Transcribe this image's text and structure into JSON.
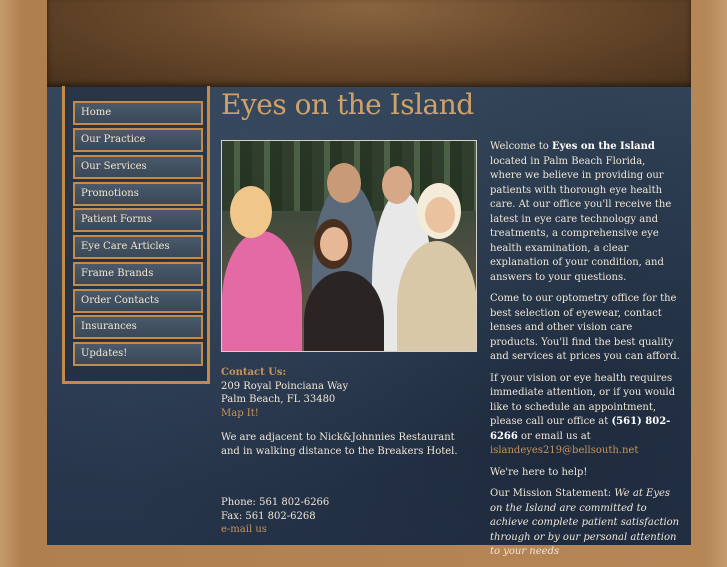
{
  "site": {
    "title": "Eyes on the Island"
  },
  "nav": [
    {
      "label": "Home"
    },
    {
      "label": "Our Practice"
    },
    {
      "label": "Our Services"
    },
    {
      "label": "Promotions"
    },
    {
      "label": "Patient Forms"
    },
    {
      "label": "Eye Care Articles"
    },
    {
      "label": "Frame Brands"
    },
    {
      "label": "Order Contacts"
    },
    {
      "label": "Insurances"
    },
    {
      "label": "Updates!"
    }
  ],
  "contact": {
    "heading": "Contact Us:",
    "address1": "209 Royal Poinciana Way",
    "address2": "Palm Beach, FL 33480",
    "map_link": "Map It!",
    "note": "We are adjacent to Nick&Johnnies Restaurant and in walking distance to the Breakers Hotel.",
    "phone": "Phone: 561 802-6266",
    "fax": "Fax: 561 802-6268",
    "email_link": "e-mail us"
  },
  "intro": {
    "p1_pre": "Welcome to ",
    "p1_bold": "Eyes on the Island",
    "p1_post": " located in Palm Beach Florida, where we believe in providing our patients with thorough eye health care. At our office you'll receive the latest in eye care technology and treatments, a comprehensive eye health examination, a clear explanation of your condition, and answers to your questions.",
    "p2": "Come to our optometry office for the best selection of eyewear, contact lenses and other vision care products. You'll find the best quality and services at prices you can afford.",
    "p3_pre": "If your vision or eye health requires immediate attention, or if you would like to schedule an appointment, please call our office at ",
    "p3_phone": "(561) 802-6266",
    "p3_mid": " or email us at ",
    "p3_email": "islandeyes219@bellsouth.net",
    "p4": "We're here to help!",
    "mission_label": "Our Mission Statement: ",
    "mission_text": "We at Eyes on the Island are committed to achieve complete patient satisfaction through or by our personal attention to your needs"
  },
  "colors": {
    "accent": "#c48a4a",
    "link": "#c9935a",
    "background": "#2b3a4c"
  }
}
